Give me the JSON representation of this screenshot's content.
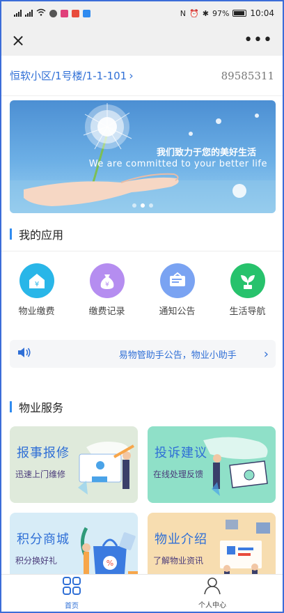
{
  "status_bar": {
    "battery": "97%",
    "time": "10:04"
  },
  "top_bar": {
    "close_icon": "×",
    "more_icon": "•••"
  },
  "address": {
    "path": "恒软小区/1号楼/1-1-101",
    "number": "89585311"
  },
  "banner": {
    "line1": "我们致力于您的美好生活",
    "line2": "We are committed to your better life",
    "slide_count": 3,
    "active_slide": 2
  },
  "my_apps": {
    "title": "我的应用",
    "items": [
      {
        "label": "物业缴费",
        "icon": "house-money-icon",
        "color": "#29b6e8"
      },
      {
        "label": "缴费记录",
        "icon": "money-bag-icon",
        "color": "#b58df0"
      },
      {
        "label": "通知公告",
        "icon": "bulletin-board-icon",
        "color": "#7aa3f2"
      },
      {
        "label": "生活导航",
        "icon": "plant-icon",
        "color": "#27c26c"
      }
    ]
  },
  "notice": {
    "text": "易物管助手公告，物业小助手"
  },
  "property_services": {
    "title": "物业服务",
    "cards": [
      {
        "title": "报事报修",
        "subtitle": "迅速上门维修",
        "bg": "#dfeadb"
      },
      {
        "title": "投诉建议",
        "subtitle": "在线处理反馈",
        "bg": "#8fe0c8"
      },
      {
        "title": "积分商城",
        "subtitle": "积分换好礼",
        "bg": "#d7ecf7"
      },
      {
        "title": "物业介绍",
        "subtitle": "了解物业资讯",
        "bg": "#f7ddb0"
      }
    ]
  },
  "tab_bar": {
    "home": "首页",
    "profile": "个人中心",
    "active_color": "#2f6fd6",
    "inactive_color": "#444444"
  }
}
